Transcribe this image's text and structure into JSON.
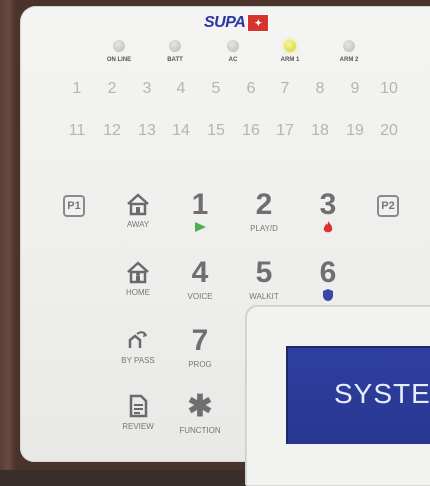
{
  "brand": {
    "logo_text": "SUPA",
    "logo_mark": "✦"
  },
  "leds": [
    {
      "label": "ON LINE",
      "on": false
    },
    {
      "label": "BATT",
      "on": false
    },
    {
      "label": "AC",
      "on": false
    },
    {
      "label": "ARM 1",
      "on": true
    },
    {
      "label": "ARM 2",
      "on": false
    }
  ],
  "zones_row1": [
    "1",
    "2",
    "3",
    "4",
    "5",
    "6",
    "7",
    "8",
    "9",
    "10"
  ],
  "zones_row2": [
    "11",
    "12",
    "13",
    "14",
    "15",
    "16",
    "17",
    "18",
    "19",
    "20"
  ],
  "panic_buttons": {
    "p1": "P1",
    "p2": "P2"
  },
  "function_keys": {
    "away": "AWAY",
    "home": "HOME",
    "bypass": "BY PASS",
    "review": "REVIEW"
  },
  "keys": {
    "k1": {
      "num": "1",
      "icon": "play-icon"
    },
    "k2": {
      "num": "2",
      "label": "PLAY/D"
    },
    "k3": {
      "num": "3",
      "icon": "fire-icon"
    },
    "k4": {
      "num": "4",
      "label": "VOICE"
    },
    "k5": {
      "num": "5",
      "label": "WALKIT"
    },
    "k6": {
      "num": "6",
      "icon": "police-badge-icon"
    },
    "k7": {
      "num": "7",
      "label": "PROG"
    },
    "star": {
      "num": "✱",
      "label": "FUNCTION"
    }
  },
  "lcd": {
    "text": "SYSTE"
  },
  "colors": {
    "lcd": "#2f3fa0",
    "led_on": "#cdd12a",
    "fire": "#d8342e",
    "play": "#4caf50",
    "police": "#3847a8"
  }
}
